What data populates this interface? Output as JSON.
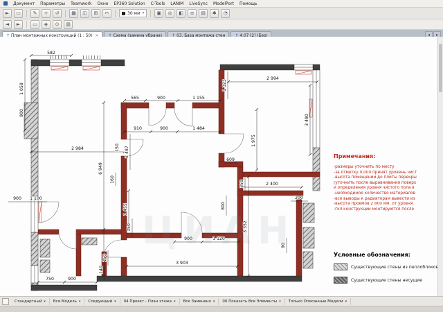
{
  "menu": {
    "items": [
      "Документ",
      "Параметры",
      "Teamwork",
      "Окно",
      "EP360 Solution",
      "C-Tools",
      "LANIM",
      "LiveSync",
      "ModelPort",
      "Помощь"
    ]
  },
  "toolbar": {
    "icons": [
      "►",
      "▭",
      "✎",
      "+",
      "↺",
      "▦",
      "◫",
      "⊞",
      "✂",
      "▣",
      "◎",
      "◧",
      "≡",
      "▤",
      "✱",
      "◔"
    ],
    "measure_value": "30 мм"
  },
  "toolbar2": {
    "icons": [
      "◄",
      "►",
      "▭",
      "◈",
      "⊙",
      "▥"
    ]
  },
  "tabs": [
    {
      "label": "План монтажных конструкций (1 : 50)"
    },
    {
      "label": "Схема (замена убрана)"
    },
    {
      "label": "03. База монтажа стен"
    },
    {
      "label": "4.07 [2] (Без)"
    }
  ],
  "icons": {
    "tab_arrow": "↑",
    "close": "×",
    "caret": "▾"
  },
  "plan": {
    "dims": [
      "582",
      "1 058",
      "900",
      "565",
      "900",
      "1 155",
      "1 323",
      "2 994",
      "3 480",
      "910",
      "900",
      "1 484",
      "2 984",
      "150",
      "2 487",
      "6 949",
      "1 975",
      "609",
      "350",
      "2 400",
      "160",
      "900",
      "1 100",
      "1 455",
      "800",
      "200",
      "3 352",
      "900",
      "1 120",
      "90",
      "150",
      "3 903",
      "140",
      "750",
      "900",
      "150"
    ]
  },
  "notes": {
    "title": "Примечания:",
    "lines": [
      "-размеры уточнить по месту",
      "-за отметку 0,000 принят уровень чист",
      "-высота помещений до плиты перекры",
      "(уточнить после выравнивания поверх",
      "и определения уровня чистого пола в",
      "-необходимое количество материалов",
      "-все выводы к радиаторам вывести из",
      "-высота проемов 2 800 мм. от уровня",
      "-гкл конструкции монтируются после"
    ]
  },
  "legend": {
    "title": "Условные обозначения:",
    "items": [
      {
        "label": "Существующие стены из пеплоблоков"
      },
      {
        "label": "Существующие стены несущие"
      }
    ]
  },
  "watermark": "ЦИАН",
  "statusbar": {
    "items": [
      "Стандартный",
      "Вся Модель",
      "Следующий",
      "04 Проект - План этажа",
      "Все Заменено",
      "00 Показать Все Элементы",
      "Только Описанные Модели"
    ]
  },
  "colors": {
    "wall_existing": "#3f3f3f",
    "wall_new": "#8f2f24",
    "note_red": "#c1271b",
    "accent_blue": "#2b5fa3"
  }
}
